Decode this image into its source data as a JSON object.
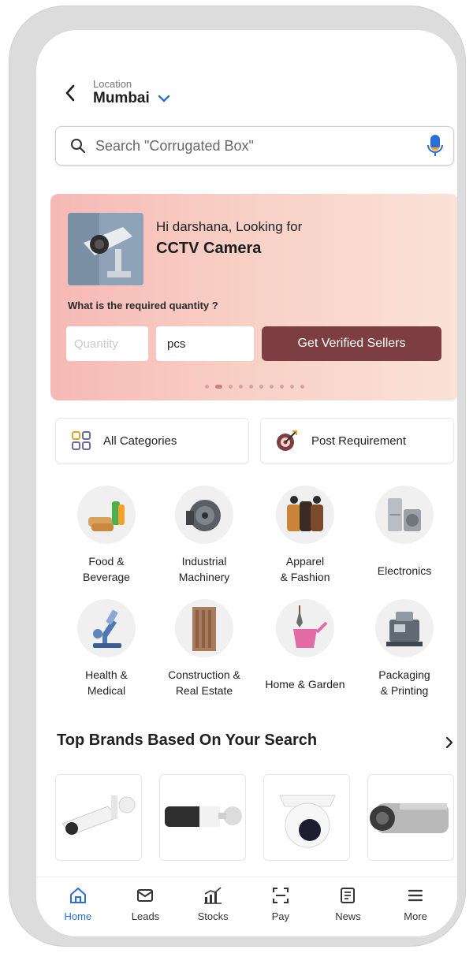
{
  "header": {
    "location_label": "Location",
    "location_value": "Mumbai"
  },
  "search": {
    "placeholder": "Search \"Corrugated Box\""
  },
  "banner": {
    "greeting": "Hi darshana, Looking for",
    "product": "CCTV Camera",
    "question": "What is the required quantity ?",
    "quantity_placeholder": "Quantity",
    "unit_value": "pcs",
    "cta_label": "Get Verified Sellers",
    "carousel_dots": 12,
    "active_dot": 2
  },
  "quick_actions": [
    {
      "label": "All Categories",
      "icon": "grid-icon"
    },
    {
      "label": "Post Requirement",
      "icon": "target-icon"
    }
  ],
  "categories": [
    {
      "label": "Food &\nBeverage",
      "icon": "food-icon"
    },
    {
      "label": "Industrial\nMachinery",
      "icon": "machinery-icon"
    },
    {
      "label": "Apparel\n& Fashion",
      "icon": "apparel-icon"
    },
    {
      "label": "Electronics",
      "icon": "electronics-icon"
    },
    {
      "label": "Health &\nMedical",
      "icon": "microscope-icon"
    },
    {
      "label": "Construction &\nReal Estate",
      "icon": "building-icon"
    },
    {
      "label": "Home & Garden",
      "icon": "watering-can-icon"
    },
    {
      "label": "Packaging\n& Printing",
      "icon": "packaging-machine-icon"
    }
  ],
  "brands_section": {
    "title": "Top Brands Based On Your Search"
  },
  "bottom_nav": [
    {
      "label": "Home",
      "icon": "home-icon",
      "active": true
    },
    {
      "label": "Leads",
      "icon": "mail-icon",
      "active": false
    },
    {
      "label": "Stocks",
      "icon": "chart-icon",
      "active": false
    },
    {
      "label": "Pay",
      "icon": "scan-icon",
      "active": false
    },
    {
      "label": "News",
      "icon": "news-icon",
      "active": false
    },
    {
      "label": "More",
      "icon": "menu-icon",
      "active": false
    }
  ],
  "colors": {
    "accent": "#2a6fd6",
    "cta": "#7d3e41",
    "mic": "#2a6fd6"
  }
}
